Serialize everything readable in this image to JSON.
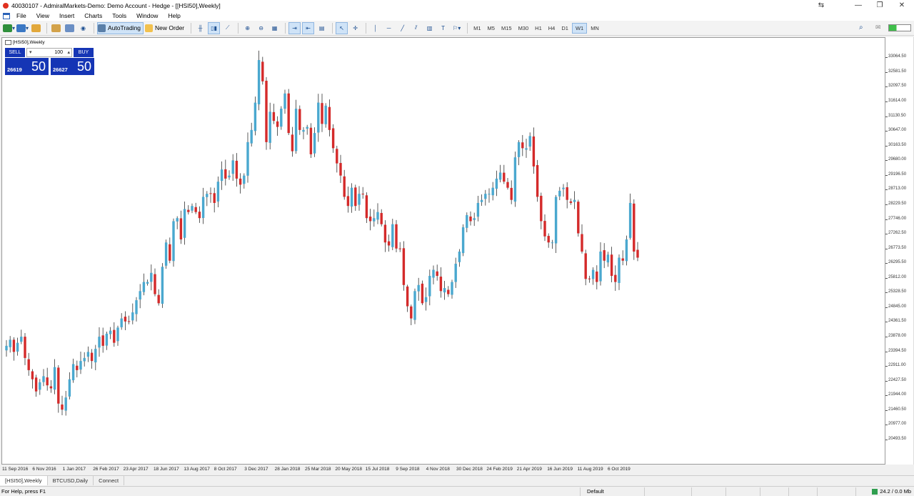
{
  "window": {
    "title": "40030107 - AdmiralMarkets-Demo: Demo Account - Hedge - [[HSI50],Weekly]",
    "controls": [
      "⇆",
      "—",
      "❐",
      "✕"
    ]
  },
  "menu": [
    "File",
    "View",
    "Insert",
    "Charts",
    "Tools",
    "Window",
    "Help"
  ],
  "toolbar": {
    "autotrading_label": "AutoTrading",
    "new_order_label": "New Order",
    "timeframes": [
      "M1",
      "M5",
      "M15",
      "M30",
      "H1",
      "H4",
      "D1",
      "W1",
      "MN"
    ],
    "active_timeframe": "W1"
  },
  "chart": {
    "label": "[HSI50],Weekly",
    "one_click": {
      "sell_label": "SELL",
      "buy_label": "BUY",
      "lot": "100",
      "sell_small": "26619",
      "sell_big": "50",
      "buy_small": "26627",
      "buy_big": "50"
    },
    "up_color": "#4aa8cf",
    "down_color": "#d42a2a",
    "wick_color": "#333333"
  },
  "chart_data": {
    "type": "candlestick",
    "title": "",
    "ylim": [
      20000,
      33400
    ],
    "y_ticks": [
      "33064.50",
      "32581.50",
      "32097.50",
      "31614.00",
      "31130.50",
      "30647.00",
      "30163.50",
      "29680.00",
      "29196.50",
      "28713.00",
      "28229.50",
      "27746.00",
      "27262.50",
      "26773.50",
      "26295.50",
      "25812.00",
      "25328.50",
      "24845.00",
      "24361.50",
      "23878.00",
      "23394.50",
      "22911.00",
      "22427.50",
      "21944.00",
      "21460.50",
      "20977.00",
      "20493.50"
    ],
    "x_ticks": [
      "11 Sep 2016",
      "6 Nov 2016",
      "1 Jan 2017",
      "26 Feb 2017",
      "23 Apr 2017",
      "18 Jun 2017",
      "13 Aug 2017",
      "8 Oct 2017",
      "3 Dec 2017",
      "28 Jan 2018",
      "25 Mar 2018",
      "20 May 2018",
      "15 Jul 2018",
      "9 Sep 2018",
      "4 Nov 2018",
      "30 Dec 2018",
      "24 Feb 2019",
      "21 Apr 2019",
      "16 Jun 2019",
      "11 Aug 2019",
      "6 Oct 2019"
    ],
    "closes": [
      23600,
      23800,
      23400,
      23700,
      23900,
      23200,
      22800,
      22500,
      22100,
      22400,
      22600,
      22300,
      22200,
      22900,
      21700,
      21500,
      21900,
      22500,
      23000,
      22800,
      23100,
      23200,
      23400,
      23100,
      23500,
      23900,
      23600,
      24000,
      24100,
      23700,
      24200,
      24500,
      24400,
      24400,
      24700,
      25100,
      25400,
      25700,
      25700,
      26000,
      25300,
      25000,
      26200,
      27000,
      26400,
      27700,
      27800,
      27100,
      28100,
      28000,
      28200,
      28000,
      27800,
      28500,
      28600,
      28600,
      28300,
      29000,
      29400,
      29100,
      29200,
      29700,
      29100,
      28900,
      29200,
      30300,
      30700,
      31600,
      33000,
      32300,
      30300,
      31300,
      31000,
      30800,
      31400,
      31900,
      30600,
      30000,
      31400,
      30700,
      30700,
      30800,
      29900,
      30600,
      31600,
      30900,
      31500,
      30700,
      30100,
      29600,
      29200,
      28500,
      28200,
      28800,
      28200,
      28600,
      28600,
      27800,
      27700,
      27800,
      28000,
      27600,
      27000,
      26900,
      27600,
      26800,
      26800,
      25600,
      24900,
      24500,
      25400,
      25600,
      25000,
      25200,
      25900,
      26100,
      25900,
      25400,
      25500,
      25300,
      25700,
      26300,
      26700,
      27500,
      27900,
      27700,
      27800,
      28300,
      28400,
      28600,
      28600,
      28800,
      29100,
      29300,
      29000,
      28800,
      28400,
      29800,
      30300,
      30100,
      30100,
      30500,
      29500,
      28500,
      27700,
      27200,
      27000,
      27000,
      28500,
      28700,
      28800,
      28400,
      28300,
      28400,
      27300,
      26700,
      25800,
      25800,
      26100,
      25700,
      26700,
      26400,
      26600,
      25900,
      25700,
      26500,
      26400,
      27100,
      28300,
      26700,
      26500
    ]
  },
  "tabs": [
    "[HSI50],Weekly",
    "BTCUSD,Daily",
    "Connect"
  ],
  "status": {
    "help": "For Help, press F1",
    "profile": "Default",
    "connection": "24.2 / 0.0 Mb"
  }
}
